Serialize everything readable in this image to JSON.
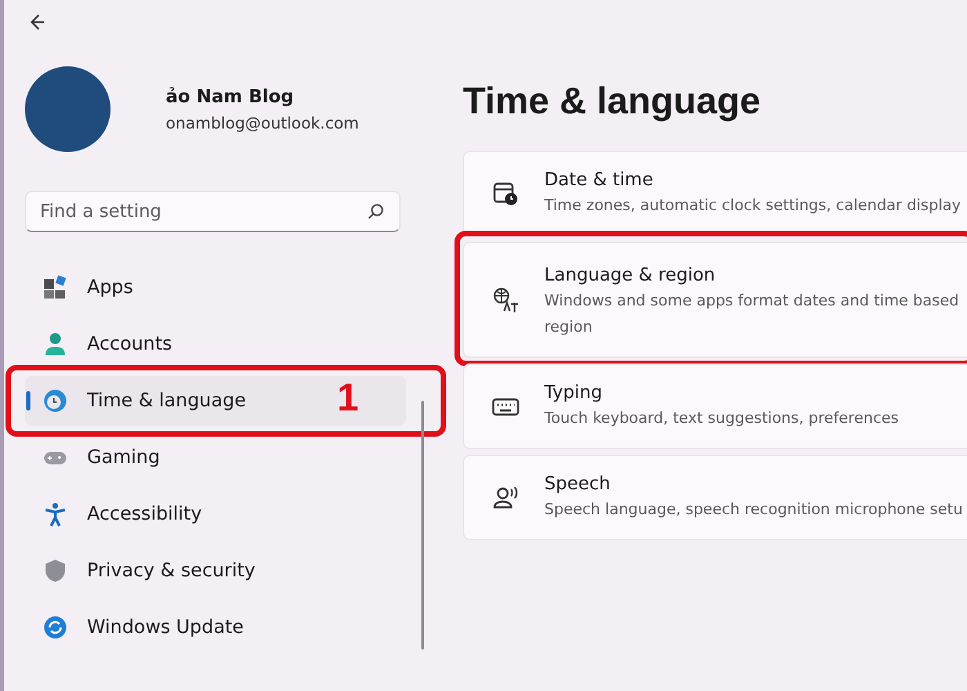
{
  "account": {
    "name": "ảo Nam Blog",
    "email": "onamblog@outlook.com"
  },
  "search": {
    "placeholder": "Find a setting"
  },
  "sidebar": {
    "items": [
      {
        "label": "Apps",
        "selected": false
      },
      {
        "label": "Accounts",
        "selected": false
      },
      {
        "label": "Time & language",
        "selected": true,
        "annotation": "1"
      },
      {
        "label": "Gaming",
        "selected": false
      },
      {
        "label": "Accessibility",
        "selected": false
      },
      {
        "label": "Privacy & security",
        "selected": false
      },
      {
        "label": "Windows Update",
        "selected": false
      }
    ]
  },
  "page": {
    "title": "Time & language",
    "cards": [
      {
        "title": "Date & time",
        "description": [
          "Time zones, automatic clock settings, calendar display"
        ],
        "annotated": false
      },
      {
        "title": "Language & region",
        "description": [
          "Windows and some apps format dates and time based",
          "region"
        ],
        "annotated": true
      },
      {
        "title": "Typing",
        "description": [
          "Touch keyboard, text suggestions, preferences"
        ],
        "annotated": false
      },
      {
        "title": "Speech",
        "description": [
          "Speech language, speech recognition microphone setu"
        ],
        "annotated": false
      }
    ]
  }
}
